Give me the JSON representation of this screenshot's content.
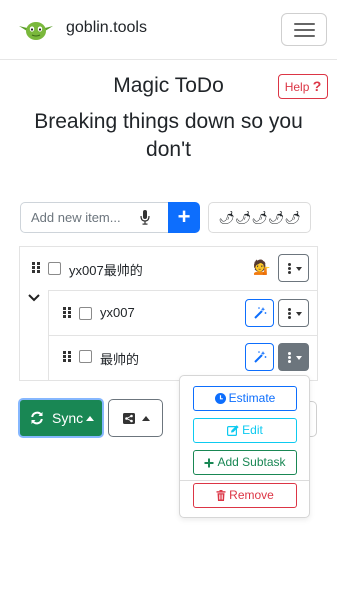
{
  "navbar": {
    "brand": "goblin.tools",
    "logo_icon": "goblin-face-icon",
    "menu_icon": "hamburger-icon"
  },
  "page": {
    "title": "Magic ToDo",
    "help_label": "Help",
    "help_mark": "?",
    "subtitle": "Breaking things down so you don't"
  },
  "input": {
    "placeholder": "Add new item...",
    "mic_icon": "microphone-icon",
    "add_label": "+",
    "spiciness": "🌶🌶🌶🌶🌶"
  },
  "tasks": [
    {
      "label": "yx007最帅的",
      "level": 0,
      "checked": false,
      "emoji": "💁"
    },
    {
      "label": "yx007",
      "level": 1,
      "checked": false
    },
    {
      "label": "最帅的",
      "level": 1,
      "checked": false
    }
  ],
  "toolbar": {
    "sync_label": "Sync",
    "sync_icon": "refresh-icon",
    "share_icon": "share-icon"
  },
  "dropdown": {
    "estimate": "Estimate",
    "edit": "Edit",
    "add_subtask": "Add Subtask",
    "remove": "Remove"
  },
  "colors": {
    "primary": "#0d6efd",
    "success": "#198754",
    "info": "#0dcaf0",
    "danger": "#dc3545",
    "secondary": "#6c757d"
  }
}
